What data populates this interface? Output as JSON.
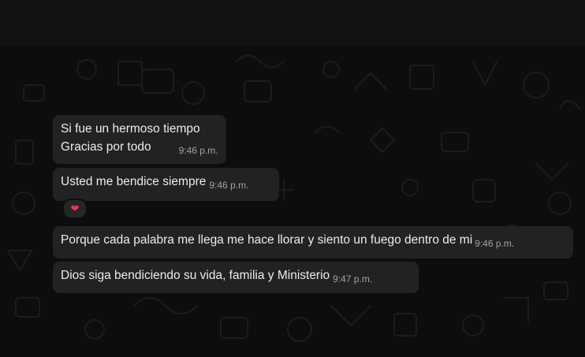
{
  "chat": {
    "messages": [
      {
        "lines": [
          "Si fue un hermoso tiempo",
          "Gracias por todo"
        ],
        "time": "9:46 p.m."
      },
      {
        "lines": [
          "Usted me bendice siempre"
        ],
        "time": "9:46 p.m.",
        "reaction": "❤"
      },
      {
        "lines": [
          "Porque cada palabra me llega me hace llorar y siento un fuego dentro de mi"
        ],
        "time": "9:46 p.m."
      },
      {
        "lines": [
          "Dios siga bendiciendo su vida, familia y Ministerio"
        ],
        "time": "9:47 p.m."
      }
    ]
  },
  "colors": {
    "bubble": "#222222",
    "text": "#e9edef",
    "timestamp": "#9ea4a8",
    "reaction_heart": "#e8384f"
  }
}
